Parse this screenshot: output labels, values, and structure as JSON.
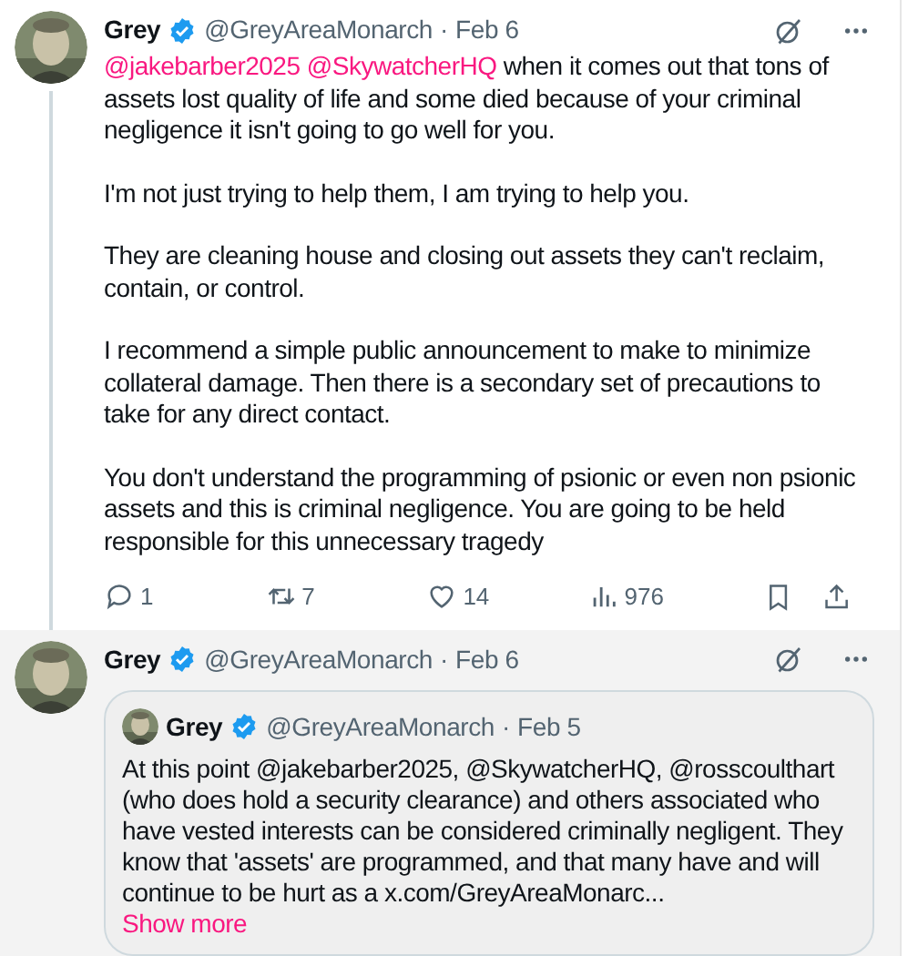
{
  "tweet": {
    "name": "Grey",
    "verified": true,
    "handle": "@GreyAreaMonarch",
    "separator": "·",
    "date": "Feb 6",
    "paragraphs": [
      [
        {
          "kind": "mention",
          "text": "@jakebarber2025"
        },
        {
          "kind": "mention",
          "text": "@SkywatcherHQ"
        },
        {
          "kind": "text",
          "text": " when it comes out that tons of assets lost quality of life and some died because of your criminal negligence it isn't going to go well for you."
        }
      ],
      [
        {
          "kind": "text",
          "text": "I'm not just trying to help them, I am trying to help you."
        }
      ],
      [
        {
          "kind": "text",
          "text": "They are cleaning house and closing out assets they can't reclaim, contain, or control."
        }
      ],
      [
        {
          "kind": "text",
          "text": "I recommend a simple public announcement to make to minimize collateral damage. Then there is a secondary set of precautions to take for any direct contact."
        }
      ],
      [
        {
          "kind": "text",
          "text": "You don't understand the programming of psionic or even non psionic assets and this is criminal negligence. You are going to be held responsible for this unnecessary tragedy"
        }
      ]
    ],
    "actions": [
      {
        "kind": "reply",
        "count": "1"
      },
      {
        "kind": "retweet",
        "count": "7"
      },
      {
        "kind": "like",
        "count": "14"
      },
      {
        "kind": "views",
        "count": "976"
      },
      {
        "kind": "bookmark"
      },
      {
        "kind": "share"
      }
    ]
  },
  "reply": {
    "name": "Grey",
    "verified": true,
    "handle": "@GreyAreaMonarch",
    "separator": "·",
    "date": "Feb 6",
    "highlighted": true,
    "quote": {
      "name": "Grey",
      "verified": true,
      "handle": "@GreyAreaMonarch",
      "separator": "·",
      "date": "Feb 5",
      "text": "At this point @jakebarber2025, @SkywatcherHQ, @rosscoulthart (who does hold a security clearance) and others associated who have vested interests can be considered criminally negligent. They know that 'assets' are programmed, and that many have and will continue to be hurt as a x.com/GreyAreaMonarc...",
      "show_more": "Show more"
    }
  }
}
